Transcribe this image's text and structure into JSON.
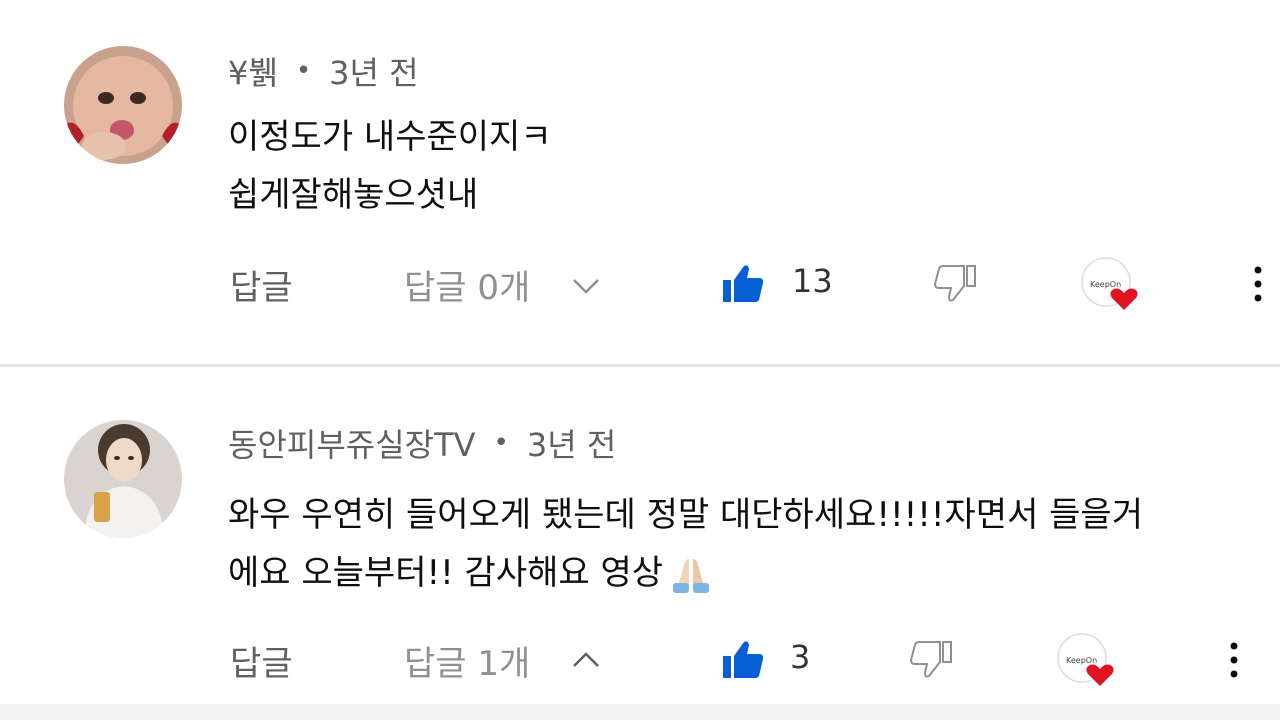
{
  "comments": [
    {
      "author": "¥뷁",
      "separator": "•",
      "time": "3년 전",
      "lines": [
        "이정도가 내수준이지ㅋ",
        "쉽게잘해놓으셧내"
      ],
      "reply_label": "답글",
      "replies_label": "답글 0개",
      "replies_state": "collapsed",
      "likes": "13",
      "heart_badge_text": "KeepOn"
    },
    {
      "author": "동안피부쥬실장TV",
      "separator": "•",
      "time": "3년 전",
      "lines": [
        "와우 우연히 들어오게 됐는데 정말 대단하세요!!!!!자면서 들을거",
        "에요 오늘부터!! 감사해요 영상"
      ],
      "trailing_emoji": "folded-hands",
      "reply_label": "답글",
      "replies_label": "답글 1개",
      "replies_state": "expanded",
      "likes": "3",
      "heart_badge_text": "KeepOn"
    }
  ],
  "colors": {
    "like_blue": "#065fd4",
    "heart_red": "#e0141e",
    "meta_gray": "#606060",
    "text": "#0f0f0f"
  }
}
